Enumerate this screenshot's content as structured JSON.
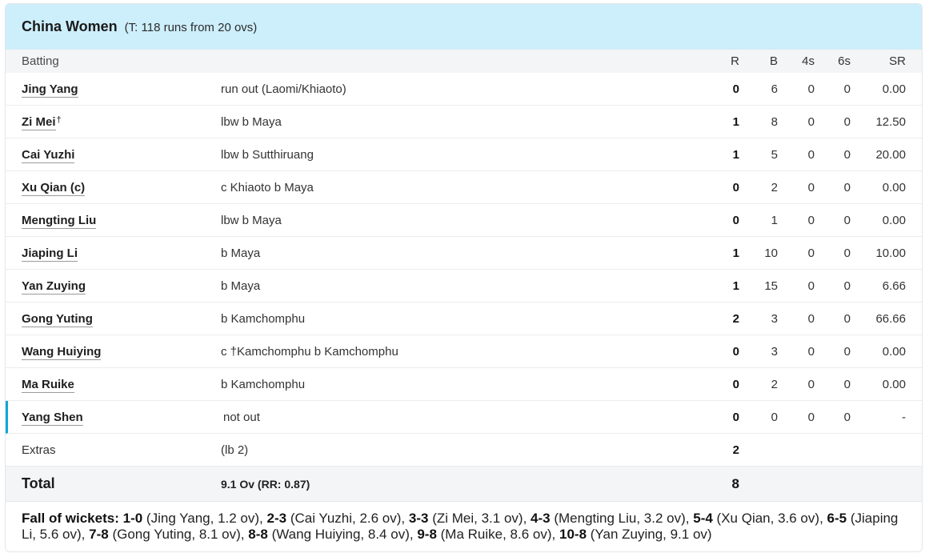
{
  "team": {
    "name": "China Women",
    "target": "(T: 118 runs from 20 ovs)"
  },
  "columns": {
    "batting": "Batting",
    "r": "R",
    "b": "B",
    "fours": "4s",
    "sixes": "6s",
    "sr": "SR"
  },
  "batters": [
    {
      "name": "Jing Yang",
      "keeper": "",
      "dismissal": "run out (Laomi/Khiaoto)",
      "r": "0",
      "b": "6",
      "fours": "0",
      "sixes": "0",
      "sr": "0.00"
    },
    {
      "name": "Zi Mei",
      "keeper": "†",
      "dismissal": "lbw b Maya",
      "r": "1",
      "b": "8",
      "fours": "0",
      "sixes": "0",
      "sr": "12.50"
    },
    {
      "name": "Cai Yuzhi",
      "keeper": "",
      "dismissal": "lbw b Sutthiruang",
      "r": "1",
      "b": "5",
      "fours": "0",
      "sixes": "0",
      "sr": "20.00"
    },
    {
      "name": "Xu Qian (c)",
      "keeper": "",
      "dismissal": "c Khiaoto b Maya",
      "r": "0",
      "b": "2",
      "fours": "0",
      "sixes": "0",
      "sr": "0.00"
    },
    {
      "name": "Mengting Liu",
      "keeper": "",
      "dismissal": "lbw b Maya",
      "r": "0",
      "b": "1",
      "fours": "0",
      "sixes": "0",
      "sr": "0.00"
    },
    {
      "name": "Jiaping Li",
      "keeper": "",
      "dismissal": "b Maya",
      "r": "1",
      "b": "10",
      "fours": "0",
      "sixes": "0",
      "sr": "10.00"
    },
    {
      "name": "Yan Zuying",
      "keeper": "",
      "dismissal": "b Maya",
      "r": "1",
      "b": "15",
      "fours": "0",
      "sixes": "0",
      "sr": "6.66"
    },
    {
      "name": "Gong Yuting",
      "keeper": "",
      "dismissal": "b Kamchomphu",
      "r": "2",
      "b": "3",
      "fours": "0",
      "sixes": "0",
      "sr": "66.66"
    },
    {
      "name": "Wang Huiying",
      "keeper": "",
      "dismissal": "c †Kamchomphu b Kamchomphu",
      "r": "0",
      "b": "3",
      "fours": "0",
      "sixes": "0",
      "sr": "0.00"
    },
    {
      "name": "Ma Ruike",
      "keeper": "",
      "dismissal": "b Kamchomphu",
      "r": "0",
      "b": "2",
      "fours": "0",
      "sixes": "0",
      "sr": "0.00"
    },
    {
      "name": "Yang Shen",
      "keeper": "",
      "dismissal": "not out",
      "r": "0",
      "b": "0",
      "fours": "0",
      "sixes": "0",
      "sr": "-"
    }
  ],
  "extras": {
    "label": "Extras",
    "detail": "(lb 2)",
    "runs": "2"
  },
  "total": {
    "label": "Total",
    "overs": "9.1 Ov (RR: 0.87)",
    "runs": "8"
  },
  "fall_of_wickets": {
    "label": "Fall of wickets:",
    "entries": [
      {
        "score": "1-0",
        "detail": "(Jing Yang, 1.2 ov)"
      },
      {
        "score": "2-3",
        "detail": "(Cai Yuzhi, 2.6 ov)"
      },
      {
        "score": "3-3",
        "detail": "(Zi Mei, 3.1 ov)"
      },
      {
        "score": "4-3",
        "detail": "(Mengting Liu, 3.2 ov)"
      },
      {
        "score": "5-4",
        "detail": "(Xu Qian, 3.6 ov)"
      },
      {
        "score": "6-5",
        "detail": "(Jiaping Li, 5.6 ov)"
      },
      {
        "score": "7-8",
        "detail": "(Gong Yuting, 8.1 ov)"
      },
      {
        "score": "8-8",
        "detail": "(Wang Huiying, 8.4 ov)"
      },
      {
        "score": "9-8",
        "detail": "(Ma Ruike, 8.6 ov)"
      },
      {
        "score": "10-8",
        "detail": "(Yan Zuying, 9.1 ov)"
      }
    ]
  },
  "colors": {
    "header_bg": "#cdeefb",
    "active_indicator": "#12a6d8",
    "row_alt_bg": "#f4f5f7"
  }
}
